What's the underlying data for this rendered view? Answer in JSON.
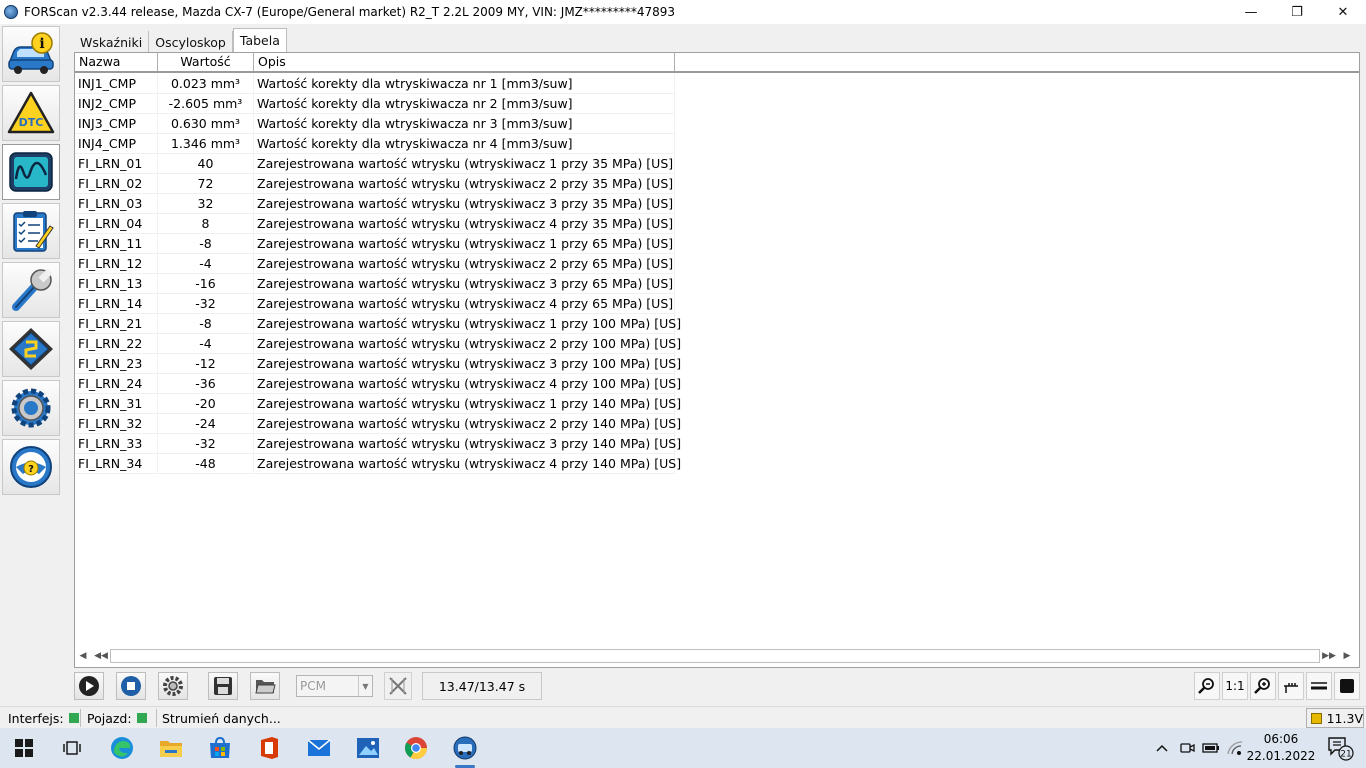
{
  "window": {
    "title": "FORScan v2.3.44 release, Mazda CX-7 (Europe/General market) R2_T 2.2L 2009 MY, VIN: JMZ*********47893",
    "minimize": "—",
    "restore": "❐",
    "close": "✕"
  },
  "sidebar": {
    "items": [
      {
        "icon": "vehicle-info-icon",
        "active": false
      },
      {
        "icon": "dtc-icon",
        "label": "DTC",
        "active": false
      },
      {
        "icon": "oscilloscope-icon",
        "active": true
      },
      {
        "icon": "checklist-icon",
        "active": false
      },
      {
        "icon": "wrench-icon",
        "active": false
      },
      {
        "icon": "chip-icon",
        "active": false
      },
      {
        "icon": "gear-icon",
        "active": false
      },
      {
        "icon": "help-icon",
        "active": false
      }
    ]
  },
  "tabs": [
    {
      "label": "Wskaźniki",
      "active": false
    },
    {
      "label": "Oscyloskop",
      "active": false
    },
    {
      "label": "Tabela",
      "active": true
    }
  ],
  "table": {
    "headers": {
      "name": "Nazwa",
      "value": "Wartość",
      "desc": "Opis"
    },
    "rows": [
      {
        "name": "INJ1_CMP",
        "value": "0.023 mm³",
        "desc": "Wartość korekty dla wtryskiwacza nr 1 [mm3/suw]"
      },
      {
        "name": "INJ2_CMP",
        "value": "-2.605 mm³",
        "desc": "Wartość korekty dla wtryskiwacza nr 2 [mm3/suw]"
      },
      {
        "name": "INJ3_CMP",
        "value": "0.630 mm³",
        "desc": "Wartość korekty dla wtryskiwacza nr 3 [mm3/suw]"
      },
      {
        "name": "INJ4_CMP",
        "value": "1.346 mm³",
        "desc": "Wartość korekty dla wtryskiwacza nr 4 [mm3/suw]"
      },
      {
        "name": "FI_LRN_01",
        "value": "40",
        "desc": "Zarejestrowana wartość wtrysku (wtryskiwacz 1 przy 35 MPa) [US]"
      },
      {
        "name": "FI_LRN_02",
        "value": "72",
        "desc": "Zarejestrowana wartość wtrysku (wtryskiwacz 2 przy 35 MPa) [US]"
      },
      {
        "name": "FI_LRN_03",
        "value": "32",
        "desc": "Zarejestrowana wartość wtrysku (wtryskiwacz 3 przy 35 MPa) [US]"
      },
      {
        "name": "FI_LRN_04",
        "value": "8",
        "desc": "Zarejestrowana wartość wtrysku (wtryskiwacz 4 przy 35 MPa) [US]"
      },
      {
        "name": "FI_LRN_11",
        "value": "-8",
        "desc": "Zarejestrowana wartość wtrysku (wtryskiwacz 1 przy 65 MPa) [US]"
      },
      {
        "name": "FI_LRN_12",
        "value": "-4",
        "desc": "Zarejestrowana wartość wtrysku (wtryskiwacz 2 przy 65 MPa) [US]"
      },
      {
        "name": "FI_LRN_13",
        "value": "-16",
        "desc": "Zarejestrowana wartość wtrysku (wtryskiwacz 3 przy 65 MPa) [US]"
      },
      {
        "name": "FI_LRN_14",
        "value": "-32",
        "desc": "Zarejestrowana wartość wtrysku (wtryskiwacz 4 przy 65 MPa) [US]"
      },
      {
        "name": "FI_LRN_21",
        "value": "-8",
        "desc": "Zarejestrowana wartość wtrysku (wtryskiwacz 1 przy 100 MPa) [US]"
      },
      {
        "name": "FI_LRN_22",
        "value": "-4",
        "desc": "Zarejestrowana wartość wtrysku (wtryskiwacz 2 przy 100 MPa) [US]"
      },
      {
        "name": "FI_LRN_23",
        "value": "-12",
        "desc": "Zarejestrowana wartość wtrysku (wtryskiwacz 3 przy 100 MPa) [US]"
      },
      {
        "name": "FI_LRN_24",
        "value": "-36",
        "desc": "Zarejestrowana wartość wtrysku (wtryskiwacz 4 przy 100 MPa) [US]"
      },
      {
        "name": "FI_LRN_31",
        "value": "-20",
        "desc": "Zarejestrowana wartość wtrysku (wtryskiwacz 1 przy 140 MPa) [US]"
      },
      {
        "name": "FI_LRN_32",
        "value": "-24",
        "desc": "Zarejestrowana wartość wtrysku (wtryskiwacz 2 przy 140 MPa) [US]"
      },
      {
        "name": "FI_LRN_33",
        "value": "-32",
        "desc": "Zarejestrowana wartość wtrysku (wtryskiwacz 3 przy 140 MPa) [US]"
      },
      {
        "name": "FI_LRN_34",
        "value": "-48",
        "desc": "Zarejestrowana wartość wtrysku (wtryskiwacz 4 przy 140 MPa) [US]"
      }
    ]
  },
  "scrollbar": {
    "first": "◀",
    "prev": "◀◀",
    "next": "▶▶",
    "last": "▶"
  },
  "toolbar": {
    "play_icon": "play-icon",
    "stop_icon": "stop-icon",
    "settings_icon": "gear-icon",
    "save_icon": "save-icon",
    "open_icon": "folder-icon",
    "module_select": {
      "value": "PCM",
      "arrow": "▼"
    },
    "time": "13.47/13.47 s",
    "zoom_ratio": "1:1"
  },
  "status": {
    "interface_label": "Interfejs:",
    "vehicle_label": "Pojazd:",
    "stream_text": "Strumień danych...",
    "voltage": "11.3V",
    "colors": {
      "interface": "#2fa84f",
      "vehicle": "#2fa84f",
      "voltage": "#e6b800"
    }
  },
  "taskbar": {
    "time": "06:06",
    "date": "22.01.2022",
    "notifications": "21"
  }
}
